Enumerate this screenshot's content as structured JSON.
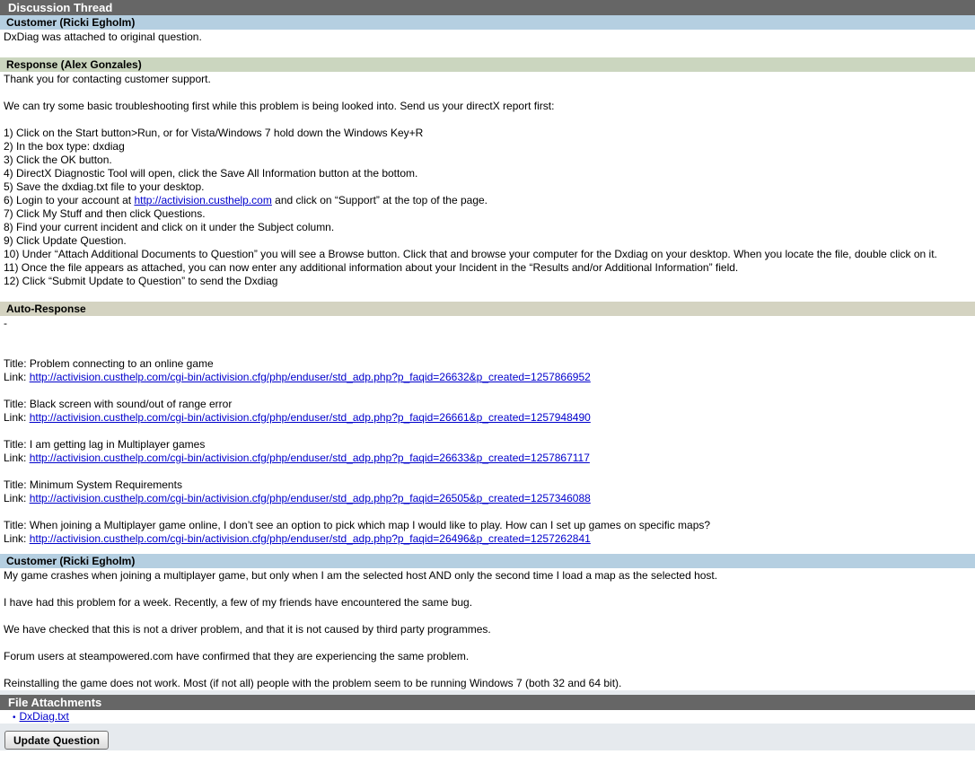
{
  "discussion": {
    "header": "Discussion Thread",
    "entries": [
      {
        "header": "Customer (Ricki Egholm)",
        "lines": [
          "DxDiag was attached to original question."
        ]
      },
      {
        "header": "Response (Alex Gonzales)",
        "intro": "Thank you for contacting customer support.",
        "intro2": "We can try some basic troubleshooting first while this problem is being looked into. Send us your directX report first:",
        "steps": [
          "1) Click on the Start button>Run, or for Vista/Windows 7 hold down the Windows Key+R",
          "2) In the box type: dxdiag",
          "3) Click the OK button.",
          "4) DirectX Diagnostic Tool will open, click the Save All Information button at the bottom.",
          "5) Save the dxdiag.txt file to your desktop."
        ],
        "step6_pre": "6) Login to your account at ",
        "step6_link": "http://activision.custhelp.com",
        "step6_post": " and click on “Support” at the top of the page.",
        "steps_b": [
          "7) Click My Stuff and then click Questions.",
          "8) Find your current incident and click on it under the Subject column.",
          "9) Click Update Question.",
          "10) Under “Attach Additional Documents to Question” you will see a Browse button. Click that and browse your computer for the Dxdiag on your desktop. When you locate the file, double click on it.",
          "11) Once the file appears as attached, you can now enter any additional information about your Incident in the “Results and/or Additional Information” field.",
          "12) Click “Submit Update to Question” to send the Dxdiag"
        ]
      },
      {
        "header": "Auto-Response",
        "dash": "-",
        "link_prefix": "Link: ",
        "items": [
          {
            "title": "Title: Problem connecting to an online game",
            "url": "http://activision.custhelp.com/cgi-bin/activision.cfg/php/enduser/std_adp.php?p_faqid=26632&p_created=1257866952"
          },
          {
            "title": "Title: Black screen with sound/out of range error",
            "url": "http://activision.custhelp.com/cgi-bin/activision.cfg/php/enduser/std_adp.php?p_faqid=26661&p_created=1257948490"
          },
          {
            "title": "Title: I am getting lag in Multiplayer games",
            "url": "http://activision.custhelp.com/cgi-bin/activision.cfg/php/enduser/std_adp.php?p_faqid=26633&p_created=1257867117"
          },
          {
            "title": "Title: Minimum System Requirements",
            "url": "http://activision.custhelp.com/cgi-bin/activision.cfg/php/enduser/std_adp.php?p_faqid=26505&p_created=1257346088"
          },
          {
            "title": "Title: When joining a Multiplayer game online, I don’t see an option to pick which map I would like to play. How can I set up games on specific maps?",
            "url": "http://activision.custhelp.com/cgi-bin/activision.cfg/php/enduser/std_adp.php?p_faqid=26496&p_created=1257262841"
          }
        ]
      },
      {
        "header": "Customer (Ricki Egholm)",
        "paragraphs": [
          "My game crashes when joining a multiplayer game, but only when I am the selected host AND only the second time I load a map as the selected host.",
          "I have had this problem for a week. Recently, a few of my friends have encountered the same bug.",
          "We have checked that this is not a driver problem, and that it is not caused by third party programmes.",
          "Forum users at steampowered.com have confirmed that they are experiencing the same problem.",
          "Reinstalling the game does not work. Most (if not all) people with the problem seem to be running Windows 7 (both 32 and 64 bit)."
        ]
      }
    ]
  },
  "attachments": {
    "header": "File Attachments",
    "bullet": "•",
    "files": [
      "DxDiag.txt"
    ]
  },
  "footer": {
    "update_button": "Update Question"
  },
  "colors": {
    "section_header": "#666666",
    "customer_header": "#b5cfe1",
    "response_header": "#cbd6bf",
    "auto_header": "#d4d3c1",
    "link": "#0000cc"
  }
}
